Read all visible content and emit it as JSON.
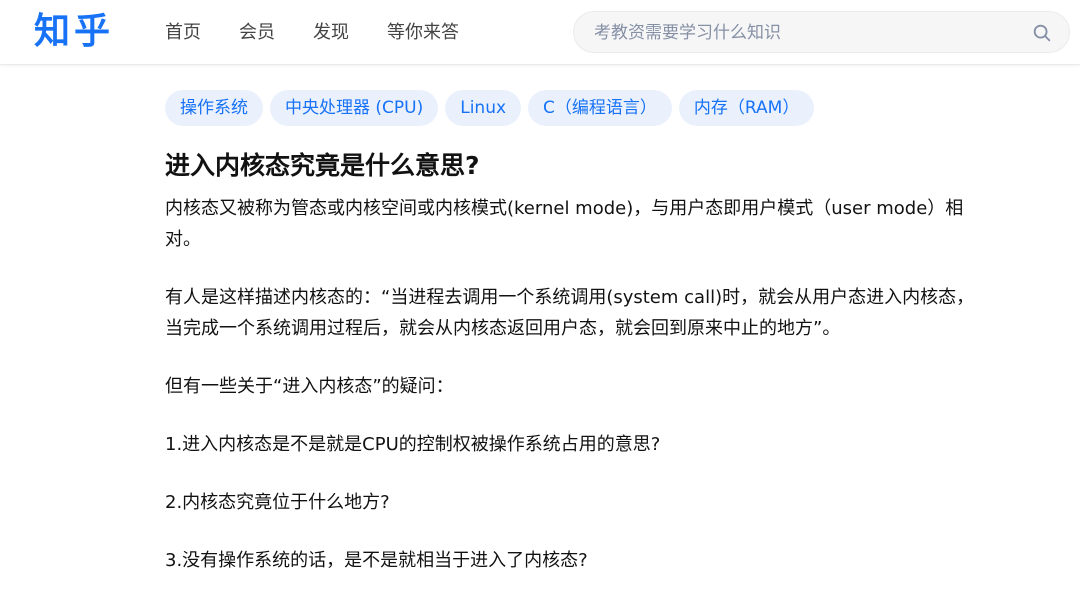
{
  "header": {
    "logo": "知乎",
    "nav": [
      "首页",
      "会员",
      "发现",
      "等你来答"
    ],
    "search_placeholder": "考教资需要学习什么知识",
    "search_icon": "search-icon"
  },
  "topics": [
    "操作系统",
    "中央处理器 (CPU)",
    "Linux",
    "C（编程语言）",
    "内存（RAM）"
  ],
  "question": {
    "title": "进入内核态究竟是什么意思?",
    "paragraphs": [
      "内核态又被称为管态或内核空间或内核模式(kernel mode)，与用户态即用户模式（user mode）相对。",
      "有人是这样描述内核态的：“当进程去调用一个系统调用(system call)时，就会从用户态进入内核态，当完成一个系统调用过程后，就会从内核态返回用户态，就会回到原来中止的地方”。",
      "但有一些关于“进入内核态”的疑问：",
      "1.进入内核态是不是就是CPU的控制权被操作系统占用的意思?",
      "2.内核态究竟位于什么地方?",
      "3.没有操作系统的话，是不是就相当于进入了内核态?"
    ]
  },
  "colors": {
    "brand": "#1772f6",
    "topic_bg": "#eaf1fd",
    "nav_text": "#444444",
    "placeholder": "#8590a6"
  }
}
